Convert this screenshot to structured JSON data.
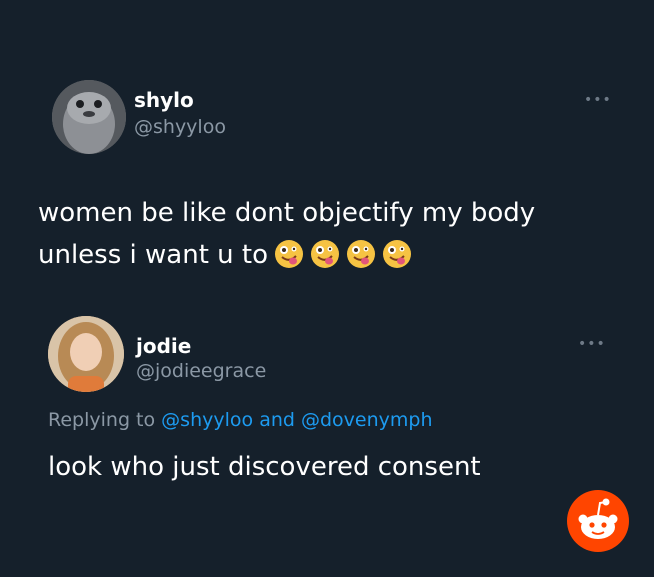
{
  "tweet1": {
    "name": "shylo",
    "handle": "@shyyloo",
    "more_label": "•••",
    "text_line1": "women be like dont objectify my body",
    "text_line2": "unless i want u to",
    "emoji_count": 4
  },
  "tweet2": {
    "name": "jodie",
    "handle": "@jodieegrace",
    "more_label": "•••",
    "replying_prefix": "Replying to",
    "mention1": "@shyyloo",
    "conjunction": "and",
    "mention2": "@dovenymph",
    "text": "look who just discovered consent"
  },
  "colors": {
    "background": "#15202b",
    "secondary_text": "#8b98a5",
    "mention_blue": "#1d9bf0",
    "reddit_orange": "#ff4500"
  },
  "icons": {
    "tweet1_avatar": "seal-avatar",
    "tweet2_avatar": "person-avatar",
    "watermark": "reddit-logo-icon"
  }
}
